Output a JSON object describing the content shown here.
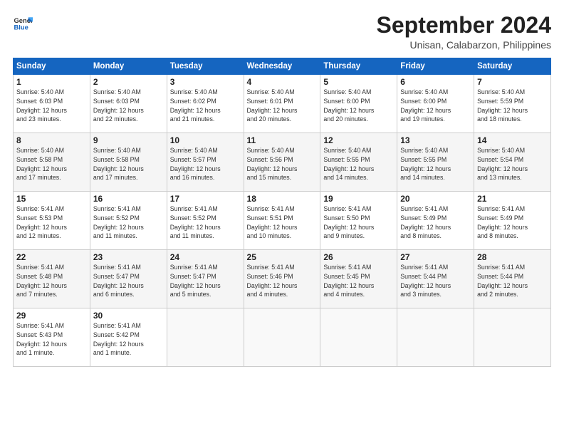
{
  "header": {
    "logo_line1": "General",
    "logo_line2": "Blue",
    "month": "September 2024",
    "location": "Unisan, Calabarzon, Philippines"
  },
  "weekdays": [
    "Sunday",
    "Monday",
    "Tuesday",
    "Wednesday",
    "Thursday",
    "Friday",
    "Saturday"
  ],
  "weeks": [
    [
      {
        "day": "1",
        "info": "Sunrise: 5:40 AM\nSunset: 6:03 PM\nDaylight: 12 hours\nand 23 minutes."
      },
      {
        "day": "2",
        "info": "Sunrise: 5:40 AM\nSunset: 6:03 PM\nDaylight: 12 hours\nand 22 minutes."
      },
      {
        "day": "3",
        "info": "Sunrise: 5:40 AM\nSunset: 6:02 PM\nDaylight: 12 hours\nand 21 minutes."
      },
      {
        "day": "4",
        "info": "Sunrise: 5:40 AM\nSunset: 6:01 PM\nDaylight: 12 hours\nand 20 minutes."
      },
      {
        "day": "5",
        "info": "Sunrise: 5:40 AM\nSunset: 6:00 PM\nDaylight: 12 hours\nand 20 minutes."
      },
      {
        "day": "6",
        "info": "Sunrise: 5:40 AM\nSunset: 6:00 PM\nDaylight: 12 hours\nand 19 minutes."
      },
      {
        "day": "7",
        "info": "Sunrise: 5:40 AM\nSunset: 5:59 PM\nDaylight: 12 hours\nand 18 minutes."
      }
    ],
    [
      {
        "day": "8",
        "info": "Sunrise: 5:40 AM\nSunset: 5:58 PM\nDaylight: 12 hours\nand 17 minutes."
      },
      {
        "day": "9",
        "info": "Sunrise: 5:40 AM\nSunset: 5:58 PM\nDaylight: 12 hours\nand 17 minutes."
      },
      {
        "day": "10",
        "info": "Sunrise: 5:40 AM\nSunset: 5:57 PM\nDaylight: 12 hours\nand 16 minutes."
      },
      {
        "day": "11",
        "info": "Sunrise: 5:40 AM\nSunset: 5:56 PM\nDaylight: 12 hours\nand 15 minutes."
      },
      {
        "day": "12",
        "info": "Sunrise: 5:40 AM\nSunset: 5:55 PM\nDaylight: 12 hours\nand 14 minutes."
      },
      {
        "day": "13",
        "info": "Sunrise: 5:40 AM\nSunset: 5:55 PM\nDaylight: 12 hours\nand 14 minutes."
      },
      {
        "day": "14",
        "info": "Sunrise: 5:40 AM\nSunset: 5:54 PM\nDaylight: 12 hours\nand 13 minutes."
      }
    ],
    [
      {
        "day": "15",
        "info": "Sunrise: 5:41 AM\nSunset: 5:53 PM\nDaylight: 12 hours\nand 12 minutes."
      },
      {
        "day": "16",
        "info": "Sunrise: 5:41 AM\nSunset: 5:52 PM\nDaylight: 12 hours\nand 11 minutes."
      },
      {
        "day": "17",
        "info": "Sunrise: 5:41 AM\nSunset: 5:52 PM\nDaylight: 12 hours\nand 11 minutes."
      },
      {
        "day": "18",
        "info": "Sunrise: 5:41 AM\nSunset: 5:51 PM\nDaylight: 12 hours\nand 10 minutes."
      },
      {
        "day": "19",
        "info": "Sunrise: 5:41 AM\nSunset: 5:50 PM\nDaylight: 12 hours\nand 9 minutes."
      },
      {
        "day": "20",
        "info": "Sunrise: 5:41 AM\nSunset: 5:49 PM\nDaylight: 12 hours\nand 8 minutes."
      },
      {
        "day": "21",
        "info": "Sunrise: 5:41 AM\nSunset: 5:49 PM\nDaylight: 12 hours\nand 8 minutes."
      }
    ],
    [
      {
        "day": "22",
        "info": "Sunrise: 5:41 AM\nSunset: 5:48 PM\nDaylight: 12 hours\nand 7 minutes."
      },
      {
        "day": "23",
        "info": "Sunrise: 5:41 AM\nSunset: 5:47 PM\nDaylight: 12 hours\nand 6 minutes."
      },
      {
        "day": "24",
        "info": "Sunrise: 5:41 AM\nSunset: 5:47 PM\nDaylight: 12 hours\nand 5 minutes."
      },
      {
        "day": "25",
        "info": "Sunrise: 5:41 AM\nSunset: 5:46 PM\nDaylight: 12 hours\nand 4 minutes."
      },
      {
        "day": "26",
        "info": "Sunrise: 5:41 AM\nSunset: 5:45 PM\nDaylight: 12 hours\nand 4 minutes."
      },
      {
        "day": "27",
        "info": "Sunrise: 5:41 AM\nSunset: 5:44 PM\nDaylight: 12 hours\nand 3 minutes."
      },
      {
        "day": "28",
        "info": "Sunrise: 5:41 AM\nSunset: 5:44 PM\nDaylight: 12 hours\nand 2 minutes."
      }
    ],
    [
      {
        "day": "29",
        "info": "Sunrise: 5:41 AM\nSunset: 5:43 PM\nDaylight: 12 hours\nand 1 minute."
      },
      {
        "day": "30",
        "info": "Sunrise: 5:41 AM\nSunset: 5:42 PM\nDaylight: 12 hours\nand 1 minute."
      },
      {
        "day": "",
        "info": ""
      },
      {
        "day": "",
        "info": ""
      },
      {
        "day": "",
        "info": ""
      },
      {
        "day": "",
        "info": ""
      },
      {
        "day": "",
        "info": ""
      }
    ]
  ]
}
